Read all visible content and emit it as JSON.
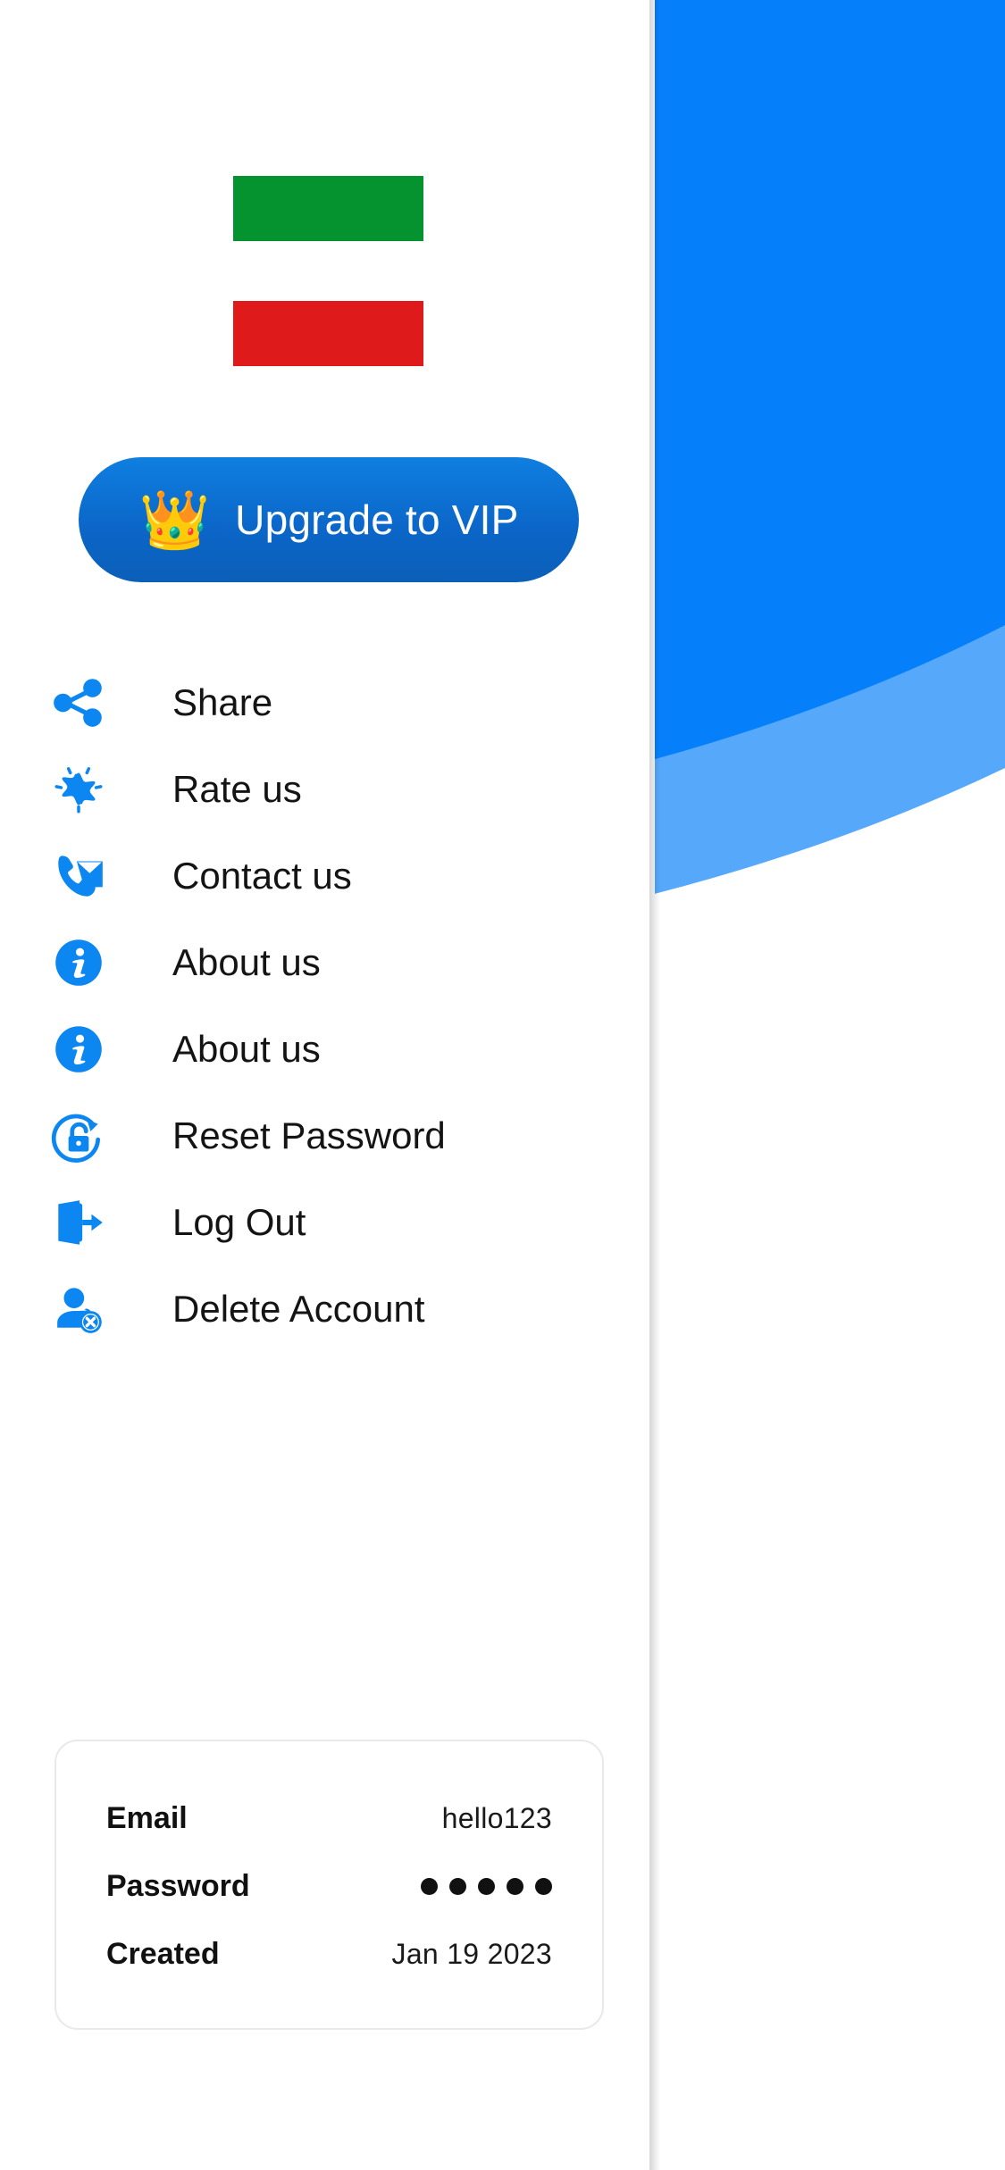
{
  "colors": {
    "primary_blue": "#0580FA",
    "light_blue": "#55A8FA",
    "field_border": "#0A7CE0",
    "green_block": "#059330",
    "red_block": "#DE1A1A",
    "vip_gradient_from": "#0F7FE0",
    "vip_gradient_to": "#0B5FB8",
    "text_dark": "#141414",
    "card_border": "#E9E9E9"
  },
  "main_panel": {
    "notification_icon": "bell-icon",
    "fields": [
      {
        "icon": "chevron-down-icon",
        "value": ""
      },
      {
        "icon": "chevron-down-icon",
        "value": ""
      },
      {
        "icon": "chevron-down-icon",
        "value": ""
      }
    ]
  },
  "drawer": {
    "blocks": [
      {
        "name": "green-block",
        "color": "#059330"
      },
      {
        "name": "red-block",
        "color": "#DE1A1A"
      }
    ],
    "vip_button": {
      "label": "Upgrade to VIP",
      "icon": "crown-icon",
      "crown_glyph": "👑"
    },
    "menu": [
      {
        "label": "Share",
        "icon": "share-icon"
      },
      {
        "label": "Rate us",
        "icon": "star-rate-icon"
      },
      {
        "label": "Contact us",
        "icon": "phone-mail-icon"
      },
      {
        "label": "About us",
        "icon": "info-circle-icon"
      },
      {
        "label": "About us",
        "icon": "info-circle-icon"
      },
      {
        "label": "Reset Password",
        "icon": "reset-password-lock-icon"
      },
      {
        "label": "Log Out",
        "icon": "logout-door-icon"
      },
      {
        "label": "Delete Account",
        "icon": "user-delete-icon"
      }
    ],
    "info_card": {
      "rows": [
        {
          "label": "Email",
          "value": "hello123",
          "type": "text"
        },
        {
          "label": "Password",
          "value": "●●●●●",
          "type": "masked",
          "dots": 5
        },
        {
          "label": "Created",
          "value": "Jan 19 2023",
          "type": "text"
        }
      ]
    }
  }
}
